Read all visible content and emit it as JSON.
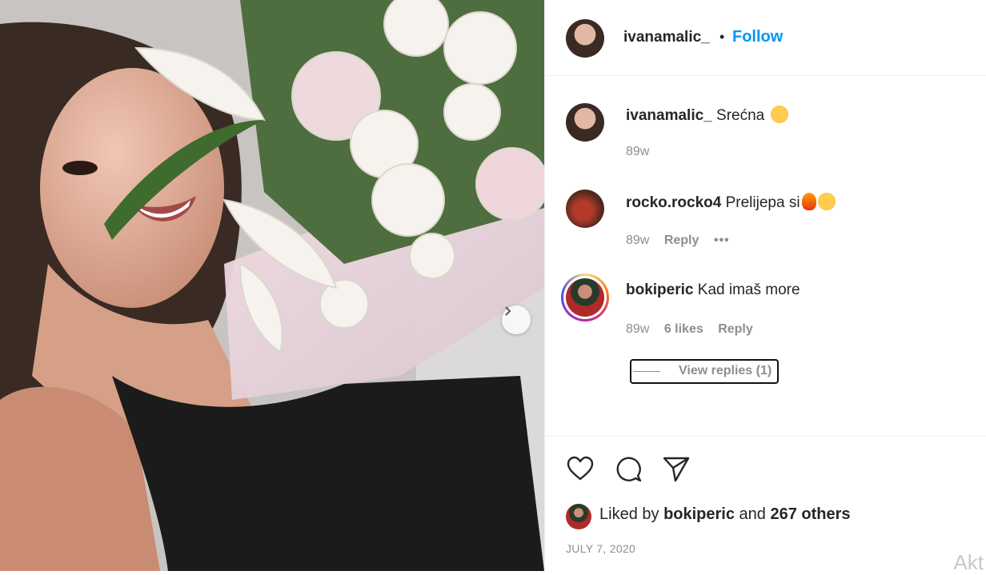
{
  "post": {
    "username": "ivanamalic_",
    "separator": "•",
    "follow_label": "Follow"
  },
  "comments": [
    {
      "username": "ivanamalic_",
      "text": "Srećna",
      "emoji": "smiling-face-with-hearts",
      "time": "89w"
    },
    {
      "username": "rocko.rocko4",
      "text": "Prelijepa si",
      "emoji": "fire-and-heart-eyes",
      "time": "89w",
      "reply_label": "Reply",
      "more": "•••"
    },
    {
      "username": "bokiperic",
      "text": "Kad imaš more",
      "time": "89w",
      "likes": "6 likes",
      "reply_label": "Reply"
    }
  ],
  "view_replies": "View replies (1)",
  "liked_by": {
    "prefix": "Liked by",
    "user": "bokiperic",
    "conj": "and",
    "others": "267 others"
  },
  "date": "JULY 7, 2020",
  "watermark": "Akt",
  "colors": {
    "link": "#0095f6",
    "text": "#262626",
    "muted": "#8e8e8e"
  }
}
